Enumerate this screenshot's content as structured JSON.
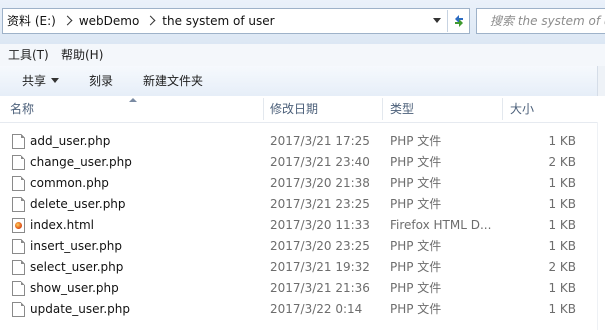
{
  "address": {
    "crumbs": [
      "资料 (E:)",
      "webDemo",
      "the system of user"
    ]
  },
  "search": {
    "placeholder": "搜索 the system of user"
  },
  "menu": {
    "items": [
      "工具(T)",
      "帮助(H)"
    ]
  },
  "commands": {
    "share": "共享",
    "burn": "刻录",
    "new_folder": "新建文件夹"
  },
  "columns": {
    "name": "名称",
    "date": "修改日期",
    "type": "类型",
    "size": "大小"
  },
  "files": [
    {
      "name": "add_user.php",
      "date": "2017/3/21 17:25",
      "type": "PHP 文件",
      "size": "1 KB",
      "icon": "php-file-icon"
    },
    {
      "name": "change_user.php",
      "date": "2017/3/21 23:40",
      "type": "PHP 文件",
      "size": "2 KB",
      "icon": "php-file-icon"
    },
    {
      "name": "common.php",
      "date": "2017/3/20 21:38",
      "type": "PHP 文件",
      "size": "1 KB",
      "icon": "php-file-icon"
    },
    {
      "name": "delete_user.php",
      "date": "2017/3/21 23:25",
      "type": "PHP 文件",
      "size": "1 KB",
      "icon": "php-file-icon"
    },
    {
      "name": "index.html",
      "date": "2017/3/20 11:33",
      "type": "Firefox HTML D...",
      "size": "1 KB",
      "icon": "firefox-html-icon"
    },
    {
      "name": "insert_user.php",
      "date": "2017/3/20 23:25",
      "type": "PHP 文件",
      "size": "1 KB",
      "icon": "php-file-icon"
    },
    {
      "name": "select_user.php",
      "date": "2017/3/21 19:32",
      "type": "PHP 文件",
      "size": "2 KB",
      "icon": "php-file-icon"
    },
    {
      "name": "show_user.php",
      "date": "2017/3/21 21:36",
      "type": "PHP 文件",
      "size": "1 KB",
      "icon": "php-file-icon"
    },
    {
      "name": "update_user.php",
      "date": "2017/3/22 0:14",
      "type": "PHP 文件",
      "size": "1 KB",
      "icon": "php-file-icon"
    }
  ]
}
